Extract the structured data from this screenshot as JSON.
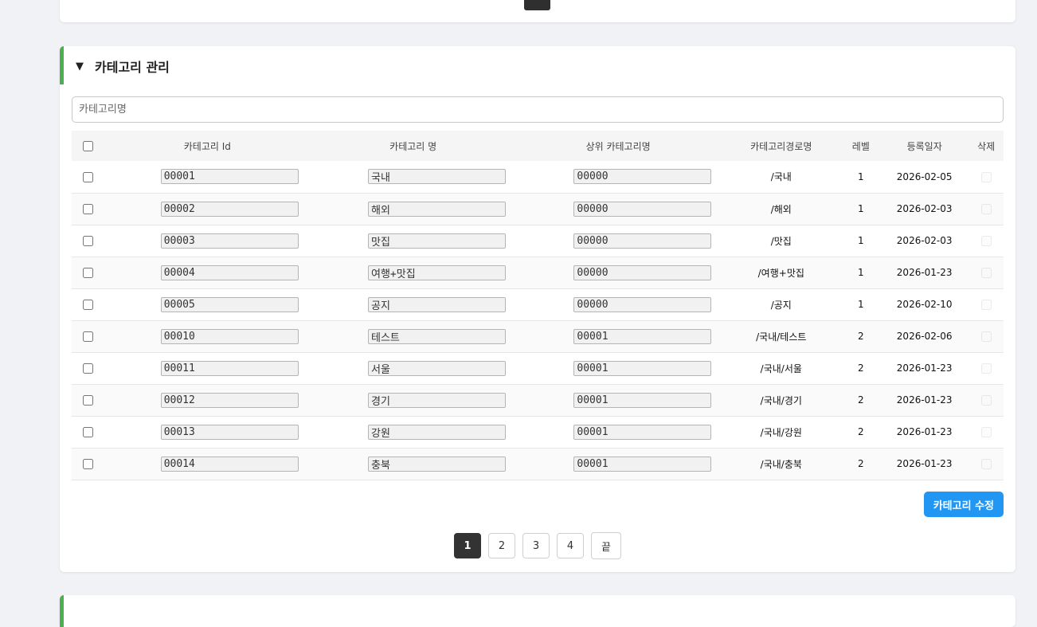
{
  "section": {
    "toggle_icon": "▼",
    "title": "카테고리 관리"
  },
  "search": {
    "placeholder": "카테고리명",
    "value": ""
  },
  "table": {
    "headers": {
      "id": "카테고리 Id",
      "name": "카테고리 명",
      "parent": "상위 카테고리명",
      "path": "카테고리경로명",
      "level": "레벨",
      "date": "등록일자",
      "delete": "삭제"
    },
    "rows": [
      {
        "id": "00001",
        "name": "국내",
        "parent": "00000",
        "path": "/국내",
        "level": "1",
        "date": "2026-02-05"
      },
      {
        "id": "00002",
        "name": "해외",
        "parent": "00000",
        "path": "/해외",
        "level": "1",
        "date": "2026-02-03"
      },
      {
        "id": "00003",
        "name": "맛집",
        "parent": "00000",
        "path": "/맛집",
        "level": "1",
        "date": "2026-02-03"
      },
      {
        "id": "00004",
        "name": "여행+맛집",
        "parent": "00000",
        "path": "/여행+맛집",
        "level": "1",
        "date": "2026-01-23"
      },
      {
        "id": "00005",
        "name": "공지",
        "parent": "00000",
        "path": "/공지",
        "level": "1",
        "date": "2026-02-10"
      },
      {
        "id": "00010",
        "name": "테스트",
        "parent": "00001",
        "path": "/국내/테스트",
        "level": "2",
        "date": "2026-02-06"
      },
      {
        "id": "00011",
        "name": "서울",
        "parent": "00001",
        "path": "/국내/서울",
        "level": "2",
        "date": "2026-01-23"
      },
      {
        "id": "00012",
        "name": "경기",
        "parent": "00001",
        "path": "/국내/경기",
        "level": "2",
        "date": "2026-01-23"
      },
      {
        "id": "00013",
        "name": "강원",
        "parent": "00001",
        "path": "/국내/강원",
        "level": "2",
        "date": "2026-01-23"
      },
      {
        "id": "00014",
        "name": "충북",
        "parent": "00001",
        "path": "/국내/충북",
        "level": "2",
        "date": "2026-01-23"
      }
    ]
  },
  "save_button": "카테고리 수정",
  "pagination": {
    "pages": [
      "1",
      "2",
      "3",
      "4"
    ],
    "active": "1",
    "last_label": "끝"
  },
  "colors": {
    "accent_bar": "#4caf50",
    "primary_button": "#2196f3",
    "active_page": "#333333"
  }
}
